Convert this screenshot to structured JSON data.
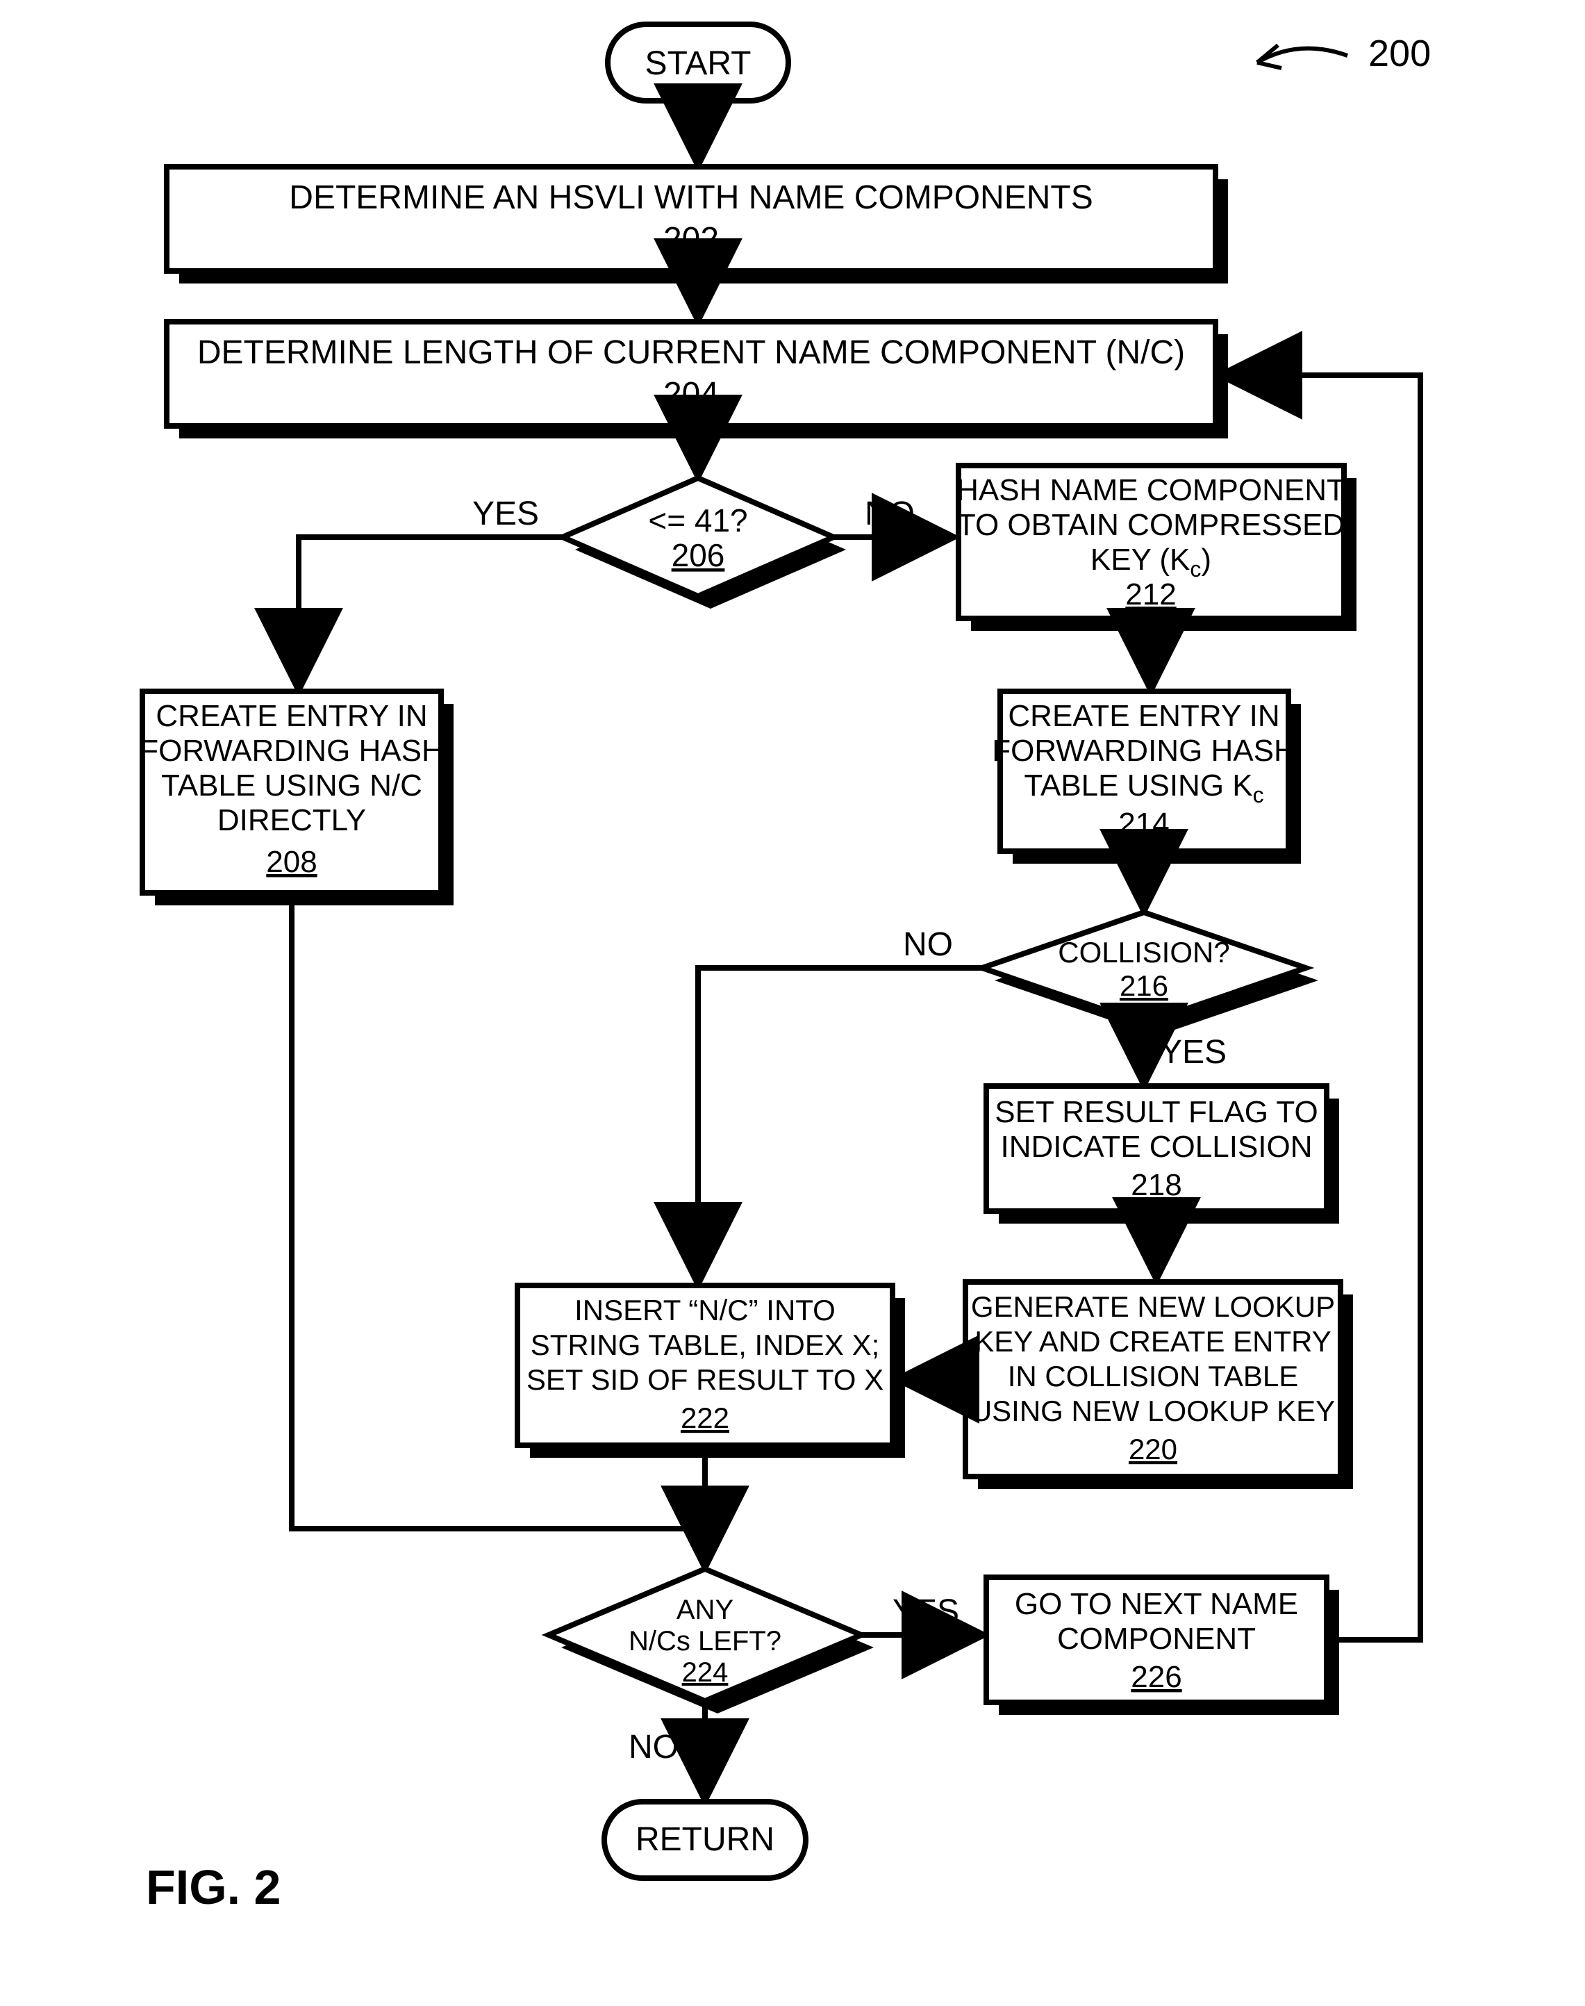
{
  "figure_label": "FIG. 2",
  "figure_ref_number": "200",
  "start": "START",
  "return": "RETURN",
  "labels": {
    "yes1": "YES",
    "no1": "NO",
    "no2": "NO",
    "yes2": "YES",
    "yes3": "YES",
    "no3": "NO"
  },
  "nodes": {
    "n202": {
      "text": "DETERMINE AN HSVLI WITH NAME COMPONENTS",
      "ref": "202"
    },
    "n204": {
      "text": "DETERMINE LENGTH OF CURRENT NAME COMPONENT (N/C)",
      "ref": "204"
    },
    "n206": {
      "text": "<= 41?",
      "ref": "206"
    },
    "n208": {
      "l1": "CREATE ENTRY IN",
      "l2": "FORWARDING HASH",
      "l3": "TABLE USING N/C",
      "l4": "DIRECTLY",
      "ref": "208"
    },
    "n212": {
      "l1": "HASH NAME COMPONENT",
      "l2": "TO OBTAIN COMPRESSED",
      "l3": "KEY (K",
      "l3sub": "c",
      "l3end": ")",
      "ref": "212"
    },
    "n214": {
      "l1": "CREATE ENTRY IN",
      "l2": "FORWARDING HASH",
      "l3": "TABLE USING K",
      "l3sub": "c",
      "ref": "214"
    },
    "n216": {
      "text": "COLLISION?",
      "ref": "216"
    },
    "n218": {
      "l1": "SET RESULT FLAG TO",
      "l2": "INDICATE COLLISION",
      "ref": "218"
    },
    "n220": {
      "l1": "GENERATE NEW LOOKUP",
      "l2": "KEY AND CREATE ENTRY",
      "l3": "IN COLLISION TABLE",
      "l4": "USING NEW LOOKUP KEY",
      "ref": "220"
    },
    "n222": {
      "l1": "INSERT “N/C” INTO",
      "l2": "STRING TABLE, INDEX X;",
      "l3": "SET SID OF RESULT TO X",
      "ref": "222"
    },
    "n224": {
      "l1": "ANY",
      "l2": "N/Cs LEFT?",
      "ref": "224"
    },
    "n226": {
      "l1": "GO TO NEXT NAME",
      "l2": "COMPONENT",
      "ref": "226"
    }
  },
  "chart_data": {
    "type": "flowchart",
    "nodes": [
      {
        "id": "start",
        "kind": "terminator",
        "label": "START"
      },
      {
        "id": "202",
        "kind": "process",
        "label": "DETERMINE AN HSVLI WITH NAME COMPONENTS"
      },
      {
        "id": "204",
        "kind": "process",
        "label": "DETERMINE LENGTH OF CURRENT NAME COMPONENT (N/C)"
      },
      {
        "id": "206",
        "kind": "decision",
        "label": "<= 41?"
      },
      {
        "id": "208",
        "kind": "process",
        "label": "CREATE ENTRY IN FORWARDING HASH TABLE USING N/C DIRECTLY"
      },
      {
        "id": "212",
        "kind": "process",
        "label": "HASH NAME COMPONENT TO OBTAIN COMPRESSED KEY (Kc)"
      },
      {
        "id": "214",
        "kind": "process",
        "label": "CREATE ENTRY IN FORWARDING HASH TABLE USING Kc"
      },
      {
        "id": "216",
        "kind": "decision",
        "label": "COLLISION?"
      },
      {
        "id": "218",
        "kind": "process",
        "label": "SET RESULT FLAG TO INDICATE COLLISION"
      },
      {
        "id": "220",
        "kind": "process",
        "label": "GENERATE NEW LOOKUP KEY AND CREATE ENTRY IN COLLISION TABLE USING NEW LOOKUP KEY"
      },
      {
        "id": "222",
        "kind": "process",
        "label": "INSERT \"N/C\" INTO STRING TABLE, INDEX X; SET SID OF RESULT TO X"
      },
      {
        "id": "224",
        "kind": "decision",
        "label": "ANY N/Cs LEFT?"
      },
      {
        "id": "226",
        "kind": "process",
        "label": "GO TO NEXT NAME COMPONENT"
      },
      {
        "id": "return",
        "kind": "terminator",
        "label": "RETURN"
      }
    ],
    "edges": [
      {
        "from": "start",
        "to": "202"
      },
      {
        "from": "202",
        "to": "204"
      },
      {
        "from": "204",
        "to": "206"
      },
      {
        "from": "206",
        "to": "208",
        "label": "YES"
      },
      {
        "from": "206",
        "to": "212",
        "label": "NO"
      },
      {
        "from": "212",
        "to": "214"
      },
      {
        "from": "214",
        "to": "216"
      },
      {
        "from": "216",
        "to": "222",
        "label": "NO"
      },
      {
        "from": "216",
        "to": "218",
        "label": "YES"
      },
      {
        "from": "218",
        "to": "220"
      },
      {
        "from": "220",
        "to": "222"
      },
      {
        "from": "208",
        "to": "224"
      },
      {
        "from": "222",
        "to": "224"
      },
      {
        "from": "224",
        "to": "226",
        "label": "YES"
      },
      {
        "from": "226",
        "to": "204"
      },
      {
        "from": "224",
        "to": "return",
        "label": "NO"
      }
    ]
  }
}
